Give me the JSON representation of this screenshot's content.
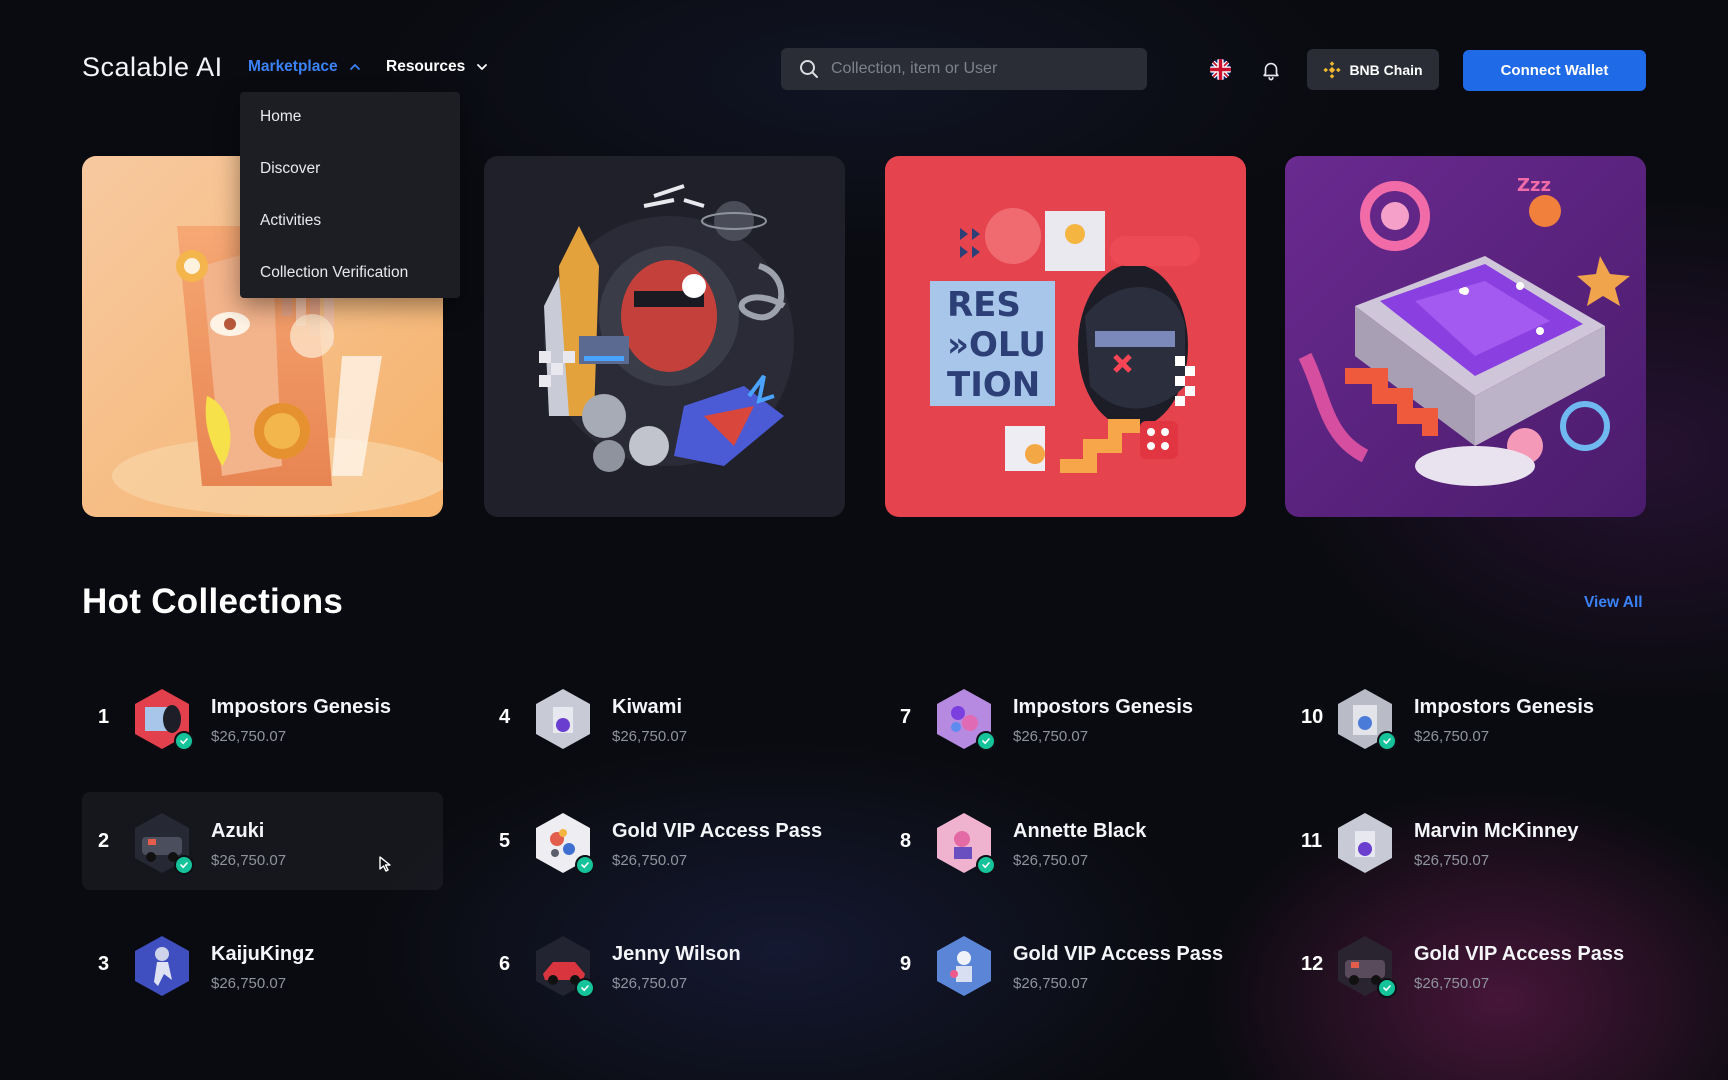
{
  "header": {
    "logo": "Scalable AI",
    "nav": {
      "marketplace": "Marketplace",
      "resources": "Resources"
    },
    "search_placeholder": "Collection, item or User",
    "chain_label": "BNB Chain",
    "connect_label": "Connect Wallet"
  },
  "dropdown": {
    "items": [
      "Home",
      "Discover",
      "Activities",
      "Collection Verification"
    ]
  },
  "hot": {
    "title": "Hot Collections",
    "view_all": "View All",
    "items": [
      {
        "rank": "1",
        "name": "Impostors Genesis",
        "price": "$26,750.07"
      },
      {
        "rank": "2",
        "name": "Azuki",
        "price": "$26,750.07"
      },
      {
        "rank": "3",
        "name": "KaijuKingz",
        "price": "$26,750.07"
      },
      {
        "rank": "4",
        "name": "Kiwami",
        "price": "$26,750.07"
      },
      {
        "rank": "5",
        "name": "Gold VIP Access Pass",
        "price": "$26,750.07"
      },
      {
        "rank": "6",
        "name": "Jenny Wilson",
        "price": "$26,750.07"
      },
      {
        "rank": "7",
        "name": "Impostors Genesis",
        "price": "$26,750.07"
      },
      {
        "rank": "8",
        "name": "Annette Black",
        "price": "$26,750.07"
      },
      {
        "rank": "9",
        "name": "Gold VIP Access Pass",
        "price": "$26,750.07"
      },
      {
        "rank": "10",
        "name": "Impostors Genesis",
        "price": "$26,750.07"
      },
      {
        "rank": "11",
        "name": "Marvin McKinney",
        "price": "$26,750.07"
      },
      {
        "rank": "12",
        "name": "Gold VIP Access Pass",
        "price": "$26,750.07"
      }
    ]
  },
  "colors": {
    "accent": "#1f6ae6",
    "link": "#3b82f6",
    "verified": "#15c39a",
    "background": "#0a0b10"
  }
}
